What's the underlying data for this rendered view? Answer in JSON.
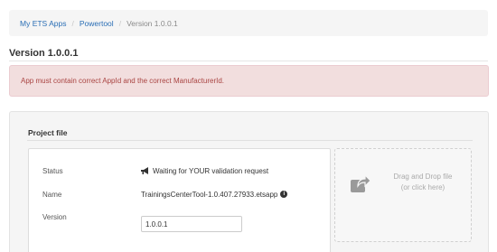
{
  "breadcrumb": {
    "items": [
      "My ETS Apps",
      "Powertool",
      "Version 1.0.0.1"
    ],
    "separator": "/"
  },
  "page": {
    "title": "Version 1.0.0.1"
  },
  "alert": {
    "message": "App must contain correct AppId and the correct ManufacturerId.",
    "color": "#a94442",
    "background": "#f2dede"
  },
  "project_file": {
    "section_title": "Project file",
    "fields": [
      {
        "label": "Status",
        "value": "Waiting for YOUR validation request",
        "icon": "megaphone-icon"
      },
      {
        "label": "Name",
        "value": "TrainingsCenterTool-1.0.407.27933.etsapp",
        "icon": "info-icon"
      },
      {
        "label": "Version",
        "value": "1.0.0.1"
      }
    ],
    "dropzone": {
      "line1": "Drag and Drop file",
      "line2": "(or click here)",
      "icon": "share-arrow-icon"
    }
  },
  "colors": {
    "link": "#2a6eb5",
    "muted": "#8a8a8a"
  }
}
